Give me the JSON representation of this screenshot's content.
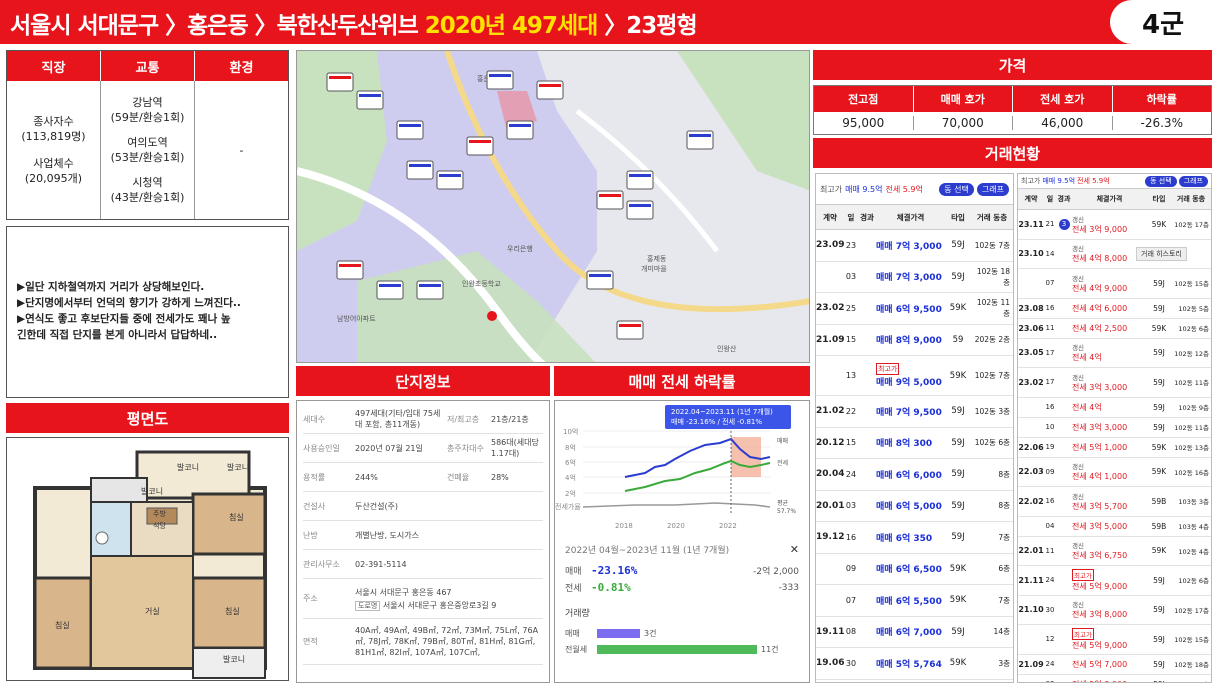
{
  "header": {
    "title_a": "서울시 서대문구 〉홍은동 〉북한산두산위브 ",
    "title_b": "2020년 497세대",
    "title_c": " 〉23평형",
    "group": "4군"
  },
  "info_table": {
    "headers": [
      "직장",
      "교통",
      "환경"
    ],
    "jobs": {
      "a": "종사자수",
      "b": "(113,819명)",
      "c": "사업체수",
      "d": "(20,095개)"
    },
    "transit": [
      {
        "name": "강남역",
        "time": "(59분/환승1회)"
      },
      {
        "name": "여의도역",
        "time": "(53분/환승1회)"
      },
      {
        "name": "시청역",
        "time": "(43분/환승1회)"
      }
    ],
    "env": "-"
  },
  "memo": [
    "▶일단 지하철역까지  거리가 상당해보인다.",
    "▶단지명에서부터 언덕의 향기가 강하게 느껴진다..",
    "▶연식도 좋고 후보단지들 중에 전세가도 꽤나 높",
    "긴한데 직접 단지를 본게 아니라서 답답하네.."
  ],
  "floorplan": {
    "title": "평면도",
    "rooms": [
      "발코니",
      "발코니",
      "발코니",
      "주방",
      "식당",
      "침실",
      "거실",
      "침실",
      "침실",
      "발코니"
    ]
  },
  "map": {
    "labels": [
      "홍은중학교",
      "우리은행",
      "홍제동",
      "개미마을",
      "인왕초등학교",
      "남방어아파트",
      "인왕산"
    ]
  },
  "complex": {
    "title": "단지정보",
    "rows": [
      {
        "k": "세대수",
        "v": "497세대(기타/임대 75세대 포함, 총11개동)",
        "k2": "저/최고층",
        "v2": "21층/21층"
      },
      {
        "k": "사용승인일",
        "v": "2020년 07월 21일",
        "k2": "총주차대수",
        "v2": "586대(세대당 1.17대)"
      },
      {
        "k": "용적률",
        "v": "244%",
        "k2": "건폐율",
        "v2": "28%"
      },
      {
        "k": "건설사",
        "v": "두산건설(주)"
      },
      {
        "k": "난방",
        "v": "개별난방, 도시가스"
      },
      {
        "k": "관리사무소",
        "v": "02-391-5114"
      },
      {
        "k": "주소",
        "v": "서울시 서대문구 홍은동 467",
        "road_tag": "도로명",
        "v3": "서울시 서대문구 홍은중앙로3길 9"
      },
      {
        "k": "면적",
        "v": "40A㎡, 49A㎡, 49B㎡, 72㎡, 73M㎡, 75L㎡, 76A㎡, 78J㎡, 78K㎡, 79B㎡, 80T㎡, 81H㎡, 81G㎡, 81H1㎡, 82I㎡, 107A㎡, 107C㎡,"
      }
    ]
  },
  "rate": {
    "title": "매매 전세 하락률",
    "tooltip_a": "2022.04~2023.11 (1년 7개월)",
    "tooltip_b": "매매 -23.16% / 전세 -0.81%",
    "yticks": [
      "10억",
      "8억",
      "6억",
      "4억",
      "2억",
      "전세가율"
    ],
    "xticks": [
      "2018",
      "2020",
      "2022"
    ],
    "legend": [
      "매매",
      "전세",
      "평균",
      "57.7%"
    ],
    "summary_period": "2022년 04월~2023년 11월 (1년 7개월)",
    "sale_label": "매매",
    "sale_pct": "-23.16%",
    "sale_amt": "-2억 2,000",
    "rent_label": "전세",
    "rent_pct": "-0.81%",
    "rent_amt": "-333",
    "volume_title": "거래량",
    "vol": [
      {
        "name": "매매",
        "count": "3건",
        "frac": 0.27
      },
      {
        "name": "전월세",
        "count": "11건",
        "frac": 1.0
      }
    ],
    "close_glyph": "✕"
  },
  "price": {
    "title": "가격",
    "headers": [
      "전고점",
      "매매 호가",
      "전세 호가",
      "하락률"
    ],
    "values": [
      "95,000",
      "70,000",
      "46,000",
      "-26.3%"
    ]
  },
  "deals": {
    "title": "거래현황",
    "left": {
      "summary_a": "최고가",
      "summary_b": "매매 9.5억",
      "summary_c": "전세 5.9억",
      "btn1": "동 선택",
      "btn2": "그래프",
      "cols": [
        "계약",
        "일",
        "경과",
        "체결가격",
        "타입",
        "거래 동층"
      ],
      "rows": [
        {
          "ym": "23.09",
          "d": "23",
          "price": "매매 7억 3,000",
          "type": "59J",
          "fl": "102동 7층"
        },
        {
          "ym": "",
          "d": "03",
          "price": "매매 7억 3,000",
          "type": "59J",
          "fl": "102동 18층"
        },
        {
          "ym": "23.02",
          "d": "25",
          "price": "매매 6억 9,500",
          "type": "59K",
          "fl": "102동 11층"
        },
        {
          "ym": "21.09",
          "d": "15",
          "price": "매매 8억 9,000",
          "type": "59",
          "fl": "202동 2층"
        },
        {
          "ym": "",
          "d": "13",
          "tag": "최고가",
          "price": "매매 9억 5,000",
          "type": "59K",
          "fl": "102동 7층"
        },
        {
          "ym": "21.02",
          "d": "22",
          "price": "매매 7억 9,500",
          "type": "59J",
          "fl": "102동 3층"
        },
        {
          "ym": "20.12",
          "d": "15",
          "price": "매매 8억 300",
          "type": "59J",
          "fl": "102동 6층"
        },
        {
          "ym": "20.04",
          "d": "24",
          "price": "매매 6억 6,000",
          "type": "59J",
          "fl": "8층"
        },
        {
          "ym": "20.01",
          "d": "03",
          "price": "매매 6억 5,000",
          "type": "59J",
          "fl": "8층"
        },
        {
          "ym": "19.12",
          "d": "16",
          "price": "매매 6억 350",
          "type": "59J",
          "fl": "7층"
        },
        {
          "ym": "",
          "d": "09",
          "price": "매매 6억 6,500",
          "type": "59K",
          "fl": "6층"
        },
        {
          "ym": "",
          "d": "07",
          "price": "매매 6억 5,500",
          "type": "59K",
          "fl": "7층"
        },
        {
          "ym": "19.11",
          "d": "08",
          "price": "매매 6억 7,000",
          "type": "59J",
          "fl": "14층"
        },
        {
          "ym": "19.06",
          "d": "30",
          "price": "매매 5억 5,764",
          "type": "59K",
          "fl": "3층"
        }
      ]
    },
    "right": {
      "summary_a": "최고가",
      "summary_b": "매매 9.5억",
      "summary_c": "전세 5.9억",
      "btn1": "동 선택",
      "btn2": "그래프",
      "cols": [
        "계약",
        "일",
        "경과",
        "체결가격",
        "타입",
        "거래 동층"
      ],
      "history_btn": "거래 히스토리",
      "rows": [
        {
          "ym": "23.11",
          "d": "21",
          "badge": "3",
          "renew": "갱신",
          "price": "전세 3억 9,000",
          "type": "59K",
          "fl": "102동 17층"
        },
        {
          "ym": "23.10",
          "d": "14",
          "renew": "갱신",
          "price": "전세 4억 8,000",
          "type": "",
          "fl": ""
        },
        {
          "ym": "",
          "d": "07",
          "renew": "갱신",
          "price": "전세 4억 9,000",
          "type": "59J",
          "fl": "102동 15층"
        },
        {
          "ym": "23.08",
          "d": "16",
          "price": "전세 4억 6,000",
          "type": "59J",
          "fl": "102동 5층"
        },
        {
          "ym": "23.06",
          "d": "11",
          "price": "전세 4억 2,500",
          "type": "59K",
          "fl": "102동 6층"
        },
        {
          "ym": "23.05",
          "d": "17",
          "renew": "갱신",
          "price": "전세 4억",
          "type": "59J",
          "fl": "102동 12층"
        },
        {
          "ym": "23.02",
          "d": "17",
          "renew": "갱신",
          "price": "전세 3억 3,000",
          "type": "59J",
          "fl": "102동 11층"
        },
        {
          "ym": "",
          "d": "16",
          "price": "전세 4억",
          "type": "59J",
          "fl": "102동 9층"
        },
        {
          "ym": "",
          "d": "10",
          "price": "전세 3억 3,000",
          "type": "59J",
          "fl": "102동 11층"
        },
        {
          "ym": "22.06",
          "d": "19",
          "price": "전세 5억 1,000",
          "type": "59K",
          "fl": "102동 13층"
        },
        {
          "ym": "22.03",
          "d": "09",
          "renew": "갱신",
          "price": "전세 4억 1,000",
          "type": "59K",
          "fl": "102동 16층"
        },
        {
          "ym": "22.02",
          "d": "16",
          "renew": "갱신",
          "price": "전세 3억 5,700",
          "type": "59B",
          "fl": "103동 3층"
        },
        {
          "ym": "",
          "d": "04",
          "price": "전세 3억 5,000",
          "type": "59B",
          "fl": "103동 4층"
        },
        {
          "ym": "22.01",
          "d": "11",
          "renew": "갱신",
          "price": "전세 3억 6,750",
          "type": "59K",
          "fl": "102동 4층"
        },
        {
          "ym": "21.11",
          "d": "24",
          "tag": "최고가",
          "price": "전세 5억 9,000",
          "type": "59J",
          "fl": "102동 6층"
        },
        {
          "ym": "21.10",
          "d": "30",
          "renew": "갱신",
          "price": "전세 3억 8,000",
          "type": "59J",
          "fl": "102동 17층"
        },
        {
          "ym": "",
          "d": "12",
          "tag": "최고가",
          "price": "전세 5억 9,000",
          "type": "59J",
          "fl": "102동 15층"
        },
        {
          "ym": "21.09",
          "d": "24",
          "price": "전세 5억 7,000",
          "type": "59J",
          "fl": "102동 18층"
        },
        {
          "ym": "",
          "d": "03",
          "price": "전세 5억 8,000",
          "type": "59J",
          "fl": "102동 3층"
        }
      ]
    }
  },
  "colors": {
    "red": "#e8141b",
    "yellow": "#ffe100",
    "blue": "#1b2fd6",
    "green": "#3aaa3a"
  }
}
